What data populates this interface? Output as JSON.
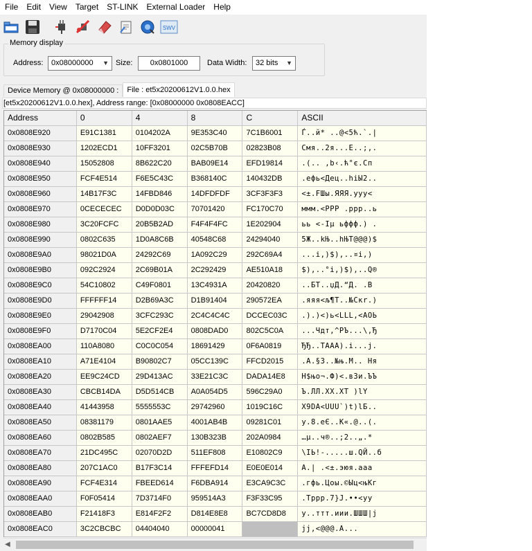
{
  "menu": [
    "File",
    "Edit",
    "View",
    "Target",
    "ST-LINK",
    "External Loader",
    "Help"
  ],
  "toolbar": {
    "icons": [
      "open-file-icon",
      "save-icon",
      "connect-icon",
      "disconnect-icon",
      "erase-icon",
      "program-verify-icon",
      "mcu-core-icon",
      "swv-icon"
    ],
    "swv_label": "SWV"
  },
  "memory_display": {
    "title": "Memory display",
    "address_label": "Address:",
    "address_value": "0x08000000",
    "size_label": "Size:",
    "size_value": "0x0801000",
    "data_width_label": "Data Width:",
    "data_width_value": "32 bits"
  },
  "tabs": [
    "Device Memory @ 0x08000000 :",
    "File : et5x20200612V1.0.0.hex"
  ],
  "info_bar": "[et5x20200612V1.0.0.hex], Address range: [0x08000000 0x0808EACC]",
  "table": {
    "headers": [
      "Address",
      "0",
      "4",
      "8",
      "C",
      "ASCII"
    ],
    "rows": [
      [
        "0x0808E920",
        "E91C1381",
        "0104202A",
        "9E353C40",
        "7C1B6001",
        "Ѓ..й* ..@<5ћ.`.|"
      ],
      [
        "0x0808E930",
        "1202ECD1",
        "10FF3201",
        "02C5B70B",
        "02823B08",
        "Смя..2я...Е..;‚."
      ],
      [
        "0x0808E940",
        "15052808",
        "8B622C20",
        "BAB09E14",
        "EFD19814",
        ".(.. ,b‹.ћ°є.Сп"
      ],
      [
        "0x0808E950",
        "FCF4E514",
        "F6E5C43C",
        "B368140C",
        "140432DB",
        ".ефь<Дец..hіЫ2.."
      ],
      [
        "0x0808E960",
        "14B17F3C",
        "14FBD846",
        "14DFDFDF",
        "3CF3F3F3",
        "<±.FШы.ЯЯЯ.ууу<"
      ],
      [
        "0x0808E970",
        "0CECECEC",
        "D0D0D03C",
        "70701420",
        "FC170C70",
        "ммм.<РРР .ррр..ь"
      ],
      [
        "0x0808E980",
        "3C20FCFC",
        "20B5B2AD",
        "F4F4F4FC",
        "1E202904",
        "ьь <-Іµ ьффф.) ."
      ],
      [
        "0x0808E990",
        "0802C635",
        "1D0A8C6B",
        "40548C68",
        "24294040",
        "5Ж..kЊ..hЊT@@@)$"
      ],
      [
        "0x0808E9A0",
        "98021D0A",
        "24292C69",
        "1A092C29",
        "292C69A4",
        "...i,)$),..¤i,)"
      ],
      [
        "0x0808E9B0",
        "092C2924",
        "2C69B01A",
        "2C292429",
        "AE510A18",
        "$),..°i,)$),..Q®"
      ],
      [
        "0x0808E9C0",
        "54C10802",
        "C49F0801",
        "13C4931A",
        "20420820",
        "..БТ..џД.“Д. .B "
      ],
      [
        "0x0808E9D0",
        "FFFFFF14",
        "D2B69A3C",
        "D1B91404",
        "290572EA",
        ".яяя<љ¶Т..№Скr.)"
      ],
      [
        "0x0808E9E0",
        "29042908",
        "3CFC293C",
        "2C4C4C4C",
        "DCCEC03C",
        ".).)<)ь<LLL,<АОЬ"
      ],
      [
        "0x0808E9F0",
        "D7170C04",
        "5E2CF2E4",
        "0808DAD0",
        "802C5C0A",
        "...Чдт,^РЪ...\\,Ђ"
      ],
      [
        "0x0808EA00",
        "110A8080",
        "C0C0C054",
        "18691429",
        "0F6A0819",
        "ЂЂ..TААА).i...j."
      ],
      [
        "0x0808EA10",
        "A71E4104",
        "B90802C7",
        "05CC139C",
        "FFCD2015",
        ".A.§З..№њ.М.. Ня"
      ],
      [
        "0x0808EA20",
        "EE9C24CD",
        "29D413AC",
        "33E21C3C",
        "DADA14E8",
        "Н$њо¬.Ф)<.в3и.ЪЪ"
      ],
      [
        "0x0808EA30",
        "CBCB14DA",
        "D5D514CB",
        "A0A054D5",
        "596C29A0",
        "Ъ.ЛЛ.ХХ.ХТ  )lY"
      ],
      [
        "0x0808EA40",
        "41443958",
        "5555553C",
        "29742960",
        "1019C16C",
        "X9DA<UUU`)t)lБ.."
      ],
      [
        "0x0808EA50",
        "08381179",
        "0801AAE5",
        "4001AB4B",
        "09281C01",
        "y.8.еЄ..K«.@..(."
      ],
      [
        "0x0808EA60",
        "0802B585",
        "0802AEF7",
        "130B323B",
        "202A0984",
        "…µ..ч®..;2..„.* "
      ],
      [
        "0x0808EA70",
        "21DC495C",
        "02070D2D",
        "511EF808",
        "E10802C9",
        "\\IЬ!-.....ш.QЙ..б"
      ],
      [
        "0x0808EA80",
        "207C1AC0",
        "B17F3C14",
        "FFFEFD14",
        "E0E0E014",
        "А.| .<±.эюя.ааа"
      ],
      [
        "0x0808EA90",
        "FCF4E314",
        "FBEED614",
        "F6DBA914",
        "E3CA9C3C",
        ".гфь.Цоы.©Ыц<њКг"
      ],
      [
        "0x0808EAA0",
        "F0F05414",
        "7D3714F0",
        "959514A3",
        "F3F33C95",
        ".Tррр.7}Ј.••<уу"
      ],
      [
        "0x0808EAB0",
        "F21418F3",
        "E814F2F2",
        "D814E8E8",
        "BC7CD8D8",
        "у..ттт.иии.ШШШ|ј"
      ],
      [
        "0x0808EAC0",
        "3C2CBCBC",
        "04404040",
        "00000041",
        "",
        "јј,<@@@.A..."
      ]
    ]
  }
}
